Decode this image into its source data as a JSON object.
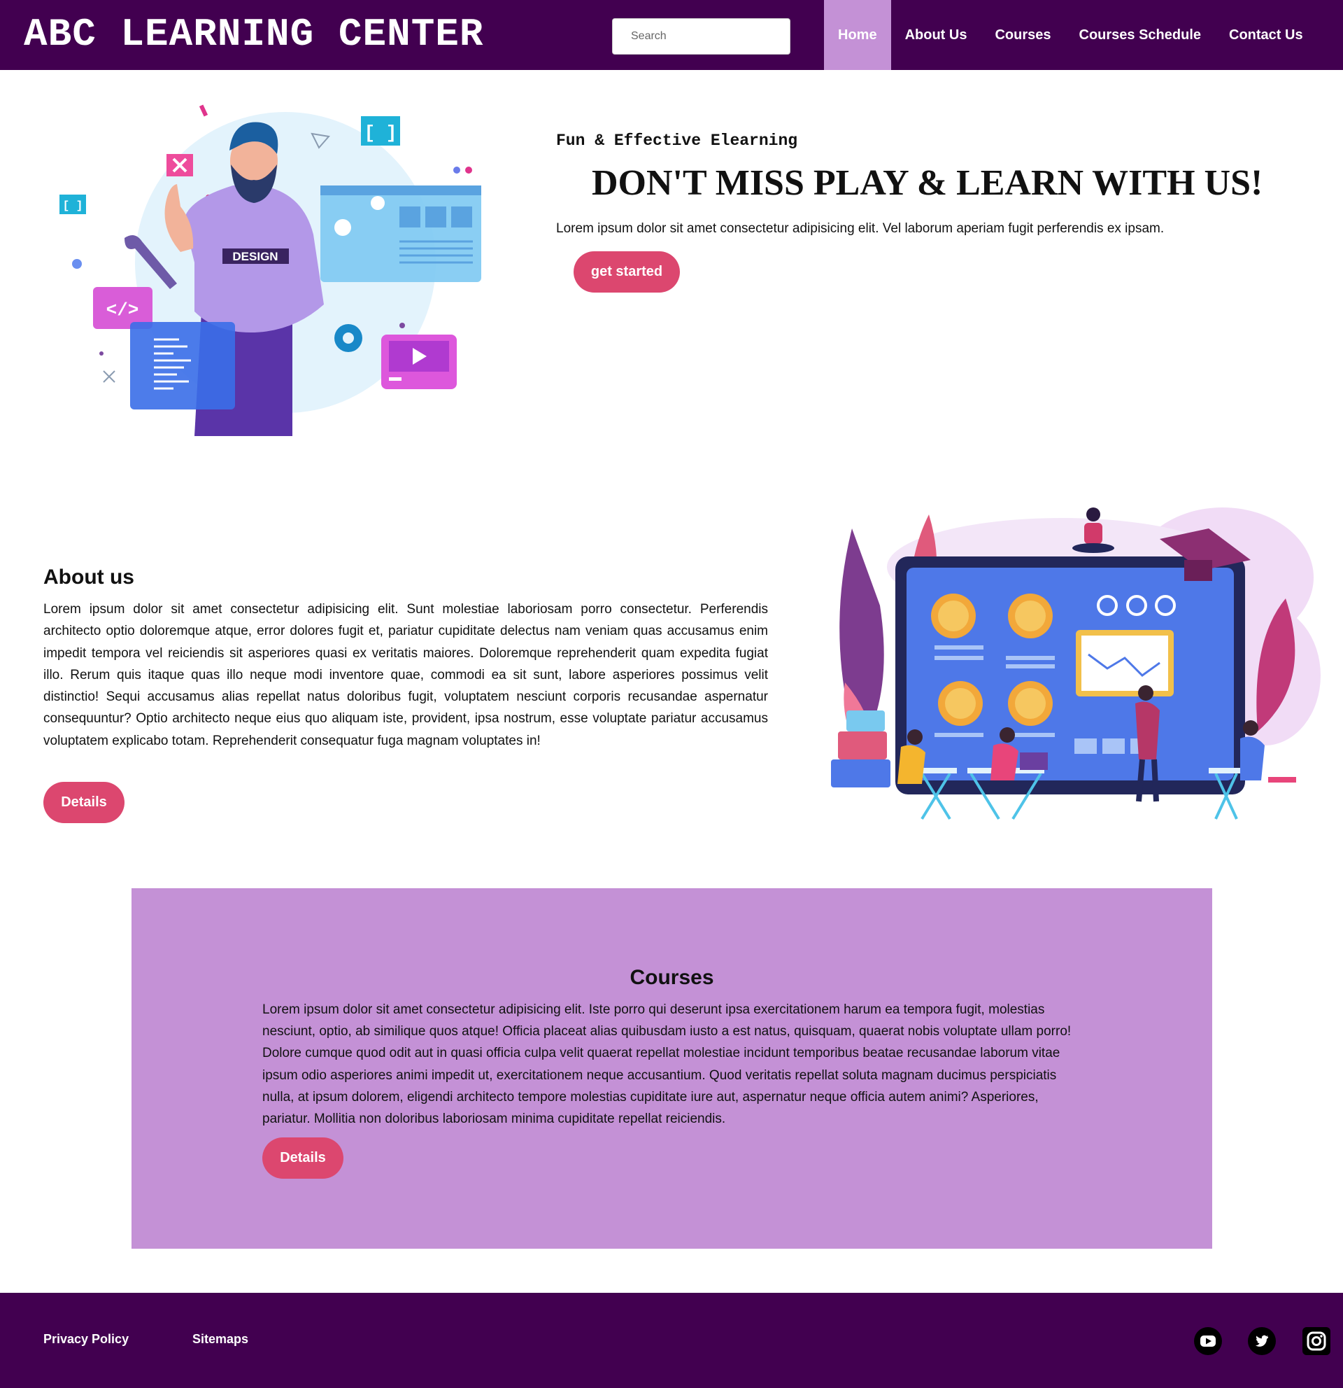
{
  "header": {
    "logo": "ABC LEARNING CENTER",
    "search_placeholder": "Search",
    "nav": [
      {
        "label": "Home",
        "active": true
      },
      {
        "label": "About Us",
        "active": false
      },
      {
        "label": "Courses",
        "active": false
      },
      {
        "label": "Courses Schedule",
        "active": false
      },
      {
        "label": "Contact Us",
        "active": false
      }
    ]
  },
  "hero": {
    "tagline": "Fun & Effective Elearning",
    "title": "DON'T MISS PLAY & LEARN WITH US!",
    "text": "Lorem ipsum dolor sit amet consectetur adipisicing elit. Vel laborum aperiam fugit perferendis ex ipsam.",
    "button": "get started",
    "image_badge": "DESIGN"
  },
  "about": {
    "title": "About us",
    "text": "Lorem ipsum dolor sit amet consectetur adipisicing elit. Sunt molestiae laboriosam porro consectetur. Perferendis architecto optio doloremque atque, error dolores fugit et, pariatur cupiditate delectus nam veniam quas accusamus enim impedit tempora vel reiciendis sit asperiores quasi ex veritatis maiores. Doloremque reprehenderit quam expedita fugiat illo. Rerum quis itaque quas illo neque modi inventore quae, commodi ea sit sunt, labore asperiores possimus velit distinctio! Sequi accusamus alias repellat natus doloribus fugit, voluptatem nesciunt corporis recusandae aspernatur consequuntur? Optio architecto neque eius quo aliquam iste, provident, ipsa nostrum, esse voluptate pariatur accusamus voluptatem explicabo totam. Reprehenderit consequatur fuga magnam voluptates in!",
    "button": "Details"
  },
  "courses": {
    "title": "Courses",
    "text": "Lorem ipsum dolor sit amet consectetur adipisicing elit. Iste porro qui deserunt ipsa exercitationem harum ea tempora fugit, molestias nesciunt, optio, ab similique quos atque! Officia placeat alias quibusdam iusto a est natus, quisquam, quaerat nobis voluptate ullam porro! Dolore cumque quod odit aut in quasi officia culpa velit quaerat repellat molestiae incidunt temporibus beatae recusandae laborum vitae ipsum odio asperiores animi impedit ut, exercitationem neque accusantium. Quod veritatis repellat soluta magnam ducimus perspiciatis nulla, at ipsum dolorem, eligendi architecto tempore molestias cupiditate iure aut, aspernatur neque officia autem animi? Asperiores, pariatur. Mollitia non doloribus laboriosam minima cupiditate repellat reiciendis.",
    "button": "Details"
  },
  "footer": {
    "privacy": "Privacy Policy",
    "sitemaps": "Sitemaps",
    "social": [
      "youtube-icon",
      "twitter-icon",
      "instagram-icon"
    ]
  },
  "colors": {
    "brand": "#420050",
    "accent_purple": "#c491d6",
    "button_pink": "#dc476f"
  }
}
